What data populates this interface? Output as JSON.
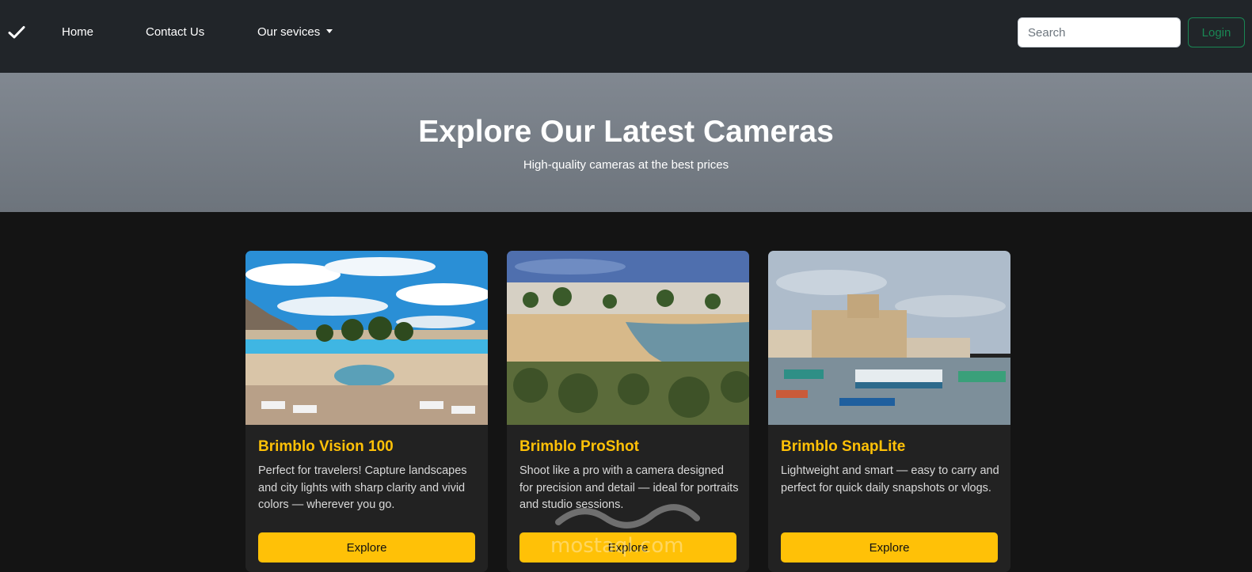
{
  "navbar": {
    "brand_icon": "check-icon",
    "links": [
      {
        "label": "Home"
      },
      {
        "label": "Contact Us"
      },
      {
        "label": "Our sevices"
      }
    ],
    "search": {
      "placeholder": "Search",
      "value": ""
    },
    "login_label": "Login",
    "colors": {
      "background": "#212529",
      "login": "#198754"
    }
  },
  "hero": {
    "title": "Explore Our Latest Cameras",
    "subtitle": "High-quality cameras at the best prices"
  },
  "cards": [
    {
      "title": "Brimblo Vision 100",
      "text": "Perfect for travelers! Capture landscapes and city lights with sharp clarity and vivid colors — wherever you go.",
      "button": "Explore",
      "image": "resort-pool-image"
    },
    {
      "title": "Brimblo ProShot",
      "text": "Shoot like a pro with a camera designed for precision and detail — ideal for portraits and studio sessions.",
      "button": "Explore",
      "image": "beach-bay-image"
    },
    {
      "title": "Brimblo SnapLite",
      "text": "Lightweight and smart — easy to carry and perfect for quick daily snapshots or vlogs.",
      "button": "Explore",
      "image": "citadel-harbor-image"
    }
  ],
  "colors": {
    "accent": "#ffc107",
    "page_background": "#141414",
    "card_background": "#222222"
  },
  "watermark": {
    "text": "mostaql.com"
  }
}
